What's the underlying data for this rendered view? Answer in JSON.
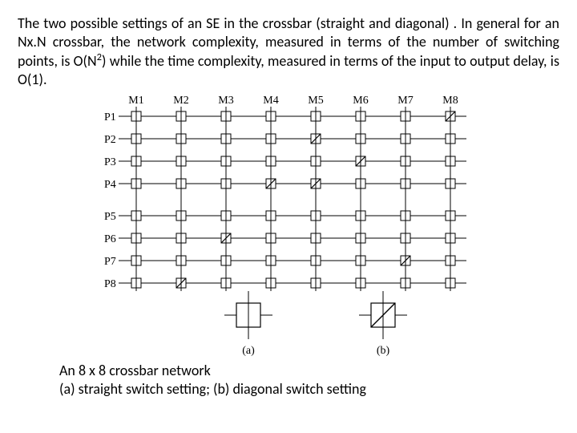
{
  "paragraph": {
    "t1": "The two possible settings of an SE in the crossbar (straight and diagonal) . In general for an Nx.N crossbar, the network complexity, measured in terms of the number of switching points, is O(N",
    "sup": "2",
    "t2": ") while the time complexity, measured in terms of the input to output delay, is O(1)."
  },
  "caption": {
    "line1": "An 8 x 8 crossbar network",
    "line2": "(a)  straight switch setting; (b) diagonal switch setting"
  },
  "diagram": {
    "columns": [
      "M1",
      "M2",
      "M3",
      "M4",
      "M5",
      "M6",
      "M7",
      "M8"
    ],
    "rows": [
      "P1",
      "P2",
      "P3",
      "P4",
      "P5",
      "P6",
      "P7",
      "P8"
    ],
    "diagonals": [
      {
        "r": 0,
        "c": 7
      },
      {
        "r": 1,
        "c": 4
      },
      {
        "r": 2,
        "c": 5
      },
      {
        "r": 3,
        "c": 3
      },
      {
        "r": 3,
        "c": 4
      },
      {
        "r": 5,
        "c": 2
      },
      {
        "r": 6,
        "c": 6
      },
      {
        "r": 7,
        "c": 1
      }
    ],
    "legend": {
      "a": "(a)",
      "b": "(b)"
    }
  }
}
